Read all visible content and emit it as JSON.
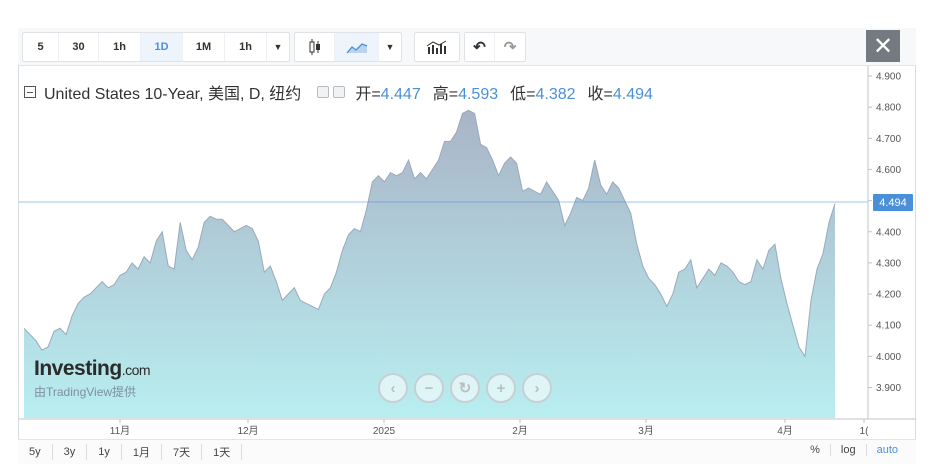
{
  "toolbar": {
    "intervals": [
      "5",
      "30",
      "1h",
      "1D",
      "1M",
      "1h"
    ],
    "active_interval": "1D",
    "icons": [
      "chevron-down-icon",
      "candlestick-icon",
      "area-chart-icon",
      "chevron-down-icon",
      "indicators-icon",
      "undo-icon",
      "redo-icon"
    ],
    "close_label": "✕"
  },
  "legend": {
    "title": "United States 10-Year, 美国, D, 纽约",
    "open_label": "开=",
    "open": "4.447",
    "high_label": "高=",
    "high": "4.593",
    "low_label": "低=",
    "low": "4.382",
    "close_label": "收=",
    "close": "4.494"
  },
  "last_price": "4.494",
  "watermark": {
    "brand": "Investing",
    "brand_suffix": ".com",
    "sub": "由TradingView提供"
  },
  "bottom": {
    "ranges": [
      "5y",
      "3y",
      "1y",
      "1月",
      "7天",
      "1天"
    ],
    "options": [
      "%",
      "log",
      "auto"
    ]
  },
  "colors": {
    "accent": "#4a90d9",
    "area_top": "#a9b4c6",
    "area_bottom": "#b8eef0",
    "line": "#9aa9bd"
  },
  "chart_data": {
    "type": "area",
    "x_tick_labels": [
      "11月",
      "12月",
      "2025",
      "2月",
      "3月",
      "4月",
      "1("
    ],
    "y_tick_labels": [
      "4.900",
      "4.800",
      "4.700",
      "4.600",
      "4.500",
      "4.400",
      "4.300",
      "4.200",
      "4.100",
      "4.000",
      "3.900"
    ],
    "ylim": [
      3.8,
      4.9
    ],
    "grid": false,
    "values": [
      4.09,
      4.07,
      4.05,
      4.02,
      4.03,
      4.08,
      4.09,
      4.07,
      4.13,
      4.17,
      4.19,
      4.2,
      4.22,
      4.24,
      4.22,
      4.23,
      4.26,
      4.27,
      4.3,
      4.28,
      4.32,
      4.3,
      4.37,
      4.4,
      4.29,
      4.28,
      4.43,
      4.34,
      4.31,
      4.35,
      4.43,
      4.45,
      4.44,
      4.44,
      4.42,
      4.4,
      4.41,
      4.42,
      4.41,
      4.37,
      4.27,
      4.29,
      4.24,
      4.18,
      4.2,
      4.22,
      4.18,
      4.17,
      4.16,
      4.15,
      4.2,
      4.22,
      4.27,
      4.34,
      4.39,
      4.41,
      4.4,
      4.47,
      4.56,
      4.58,
      4.56,
      4.59,
      4.58,
      4.59,
      4.63,
      4.57,
      4.59,
      4.57,
      4.6,
      4.63,
      4.69,
      4.69,
      4.72,
      4.78,
      4.79,
      4.78,
      4.68,
      4.67,
      4.63,
      4.58,
      4.62,
      4.64,
      4.62,
      4.53,
      4.54,
      4.53,
      4.52,
      4.56,
      4.53,
      4.5,
      4.42,
      4.46,
      4.51,
      4.5,
      4.54,
      4.63,
      4.55,
      4.52,
      4.56,
      4.54,
      4.5,
      4.46,
      4.36,
      4.29,
      4.25,
      4.23,
      4.2,
      4.16,
      4.2,
      4.27,
      4.28,
      4.31,
      4.22,
      4.25,
      4.28,
      4.26,
      4.3,
      4.29,
      4.27,
      4.24,
      4.23,
      4.24,
      4.31,
      4.28,
      4.34,
      4.36,
      4.25,
      4.17,
      4.1,
      4.03,
      4.0,
      4.18,
      4.28,
      4.33,
      4.43,
      4.49
    ]
  }
}
